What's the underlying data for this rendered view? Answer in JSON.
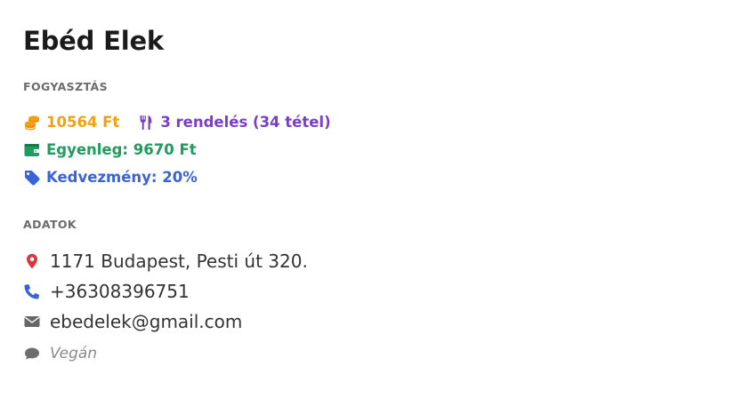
{
  "customer": {
    "name": "Ebéd Elek"
  },
  "consumption": {
    "section_label": "FOGYASZTÁS",
    "total_spent": "10564 Ft",
    "orders": "3 rendelés (34 tétel)",
    "balance": "Egyenleg: 9670 Ft",
    "discount": "Kedvezmény: 20%"
  },
  "details": {
    "section_label": "ADATOK",
    "address": "1171 Budapest, Pesti út 320.",
    "phone": "+36308396751",
    "email": "ebedelek@gmail.com",
    "note": "Vegán"
  },
  "icons": {
    "total_spent": "coins-icon",
    "orders": "utensils-icon",
    "balance": "wallet-icon",
    "discount": "tag-icon",
    "address": "map-marker-icon",
    "phone": "phone-icon",
    "email": "envelope-icon",
    "note": "comment-icon"
  },
  "colors": {
    "spent": "#f2a014",
    "orders": "#7b3fc5",
    "balance": "#1f9c5e",
    "discount": "#3a63d6",
    "address_icon": "#d9363e",
    "phone_icon": "#3a63d6",
    "email_icon": "#666666",
    "note_icon": "#6e6e6e"
  }
}
